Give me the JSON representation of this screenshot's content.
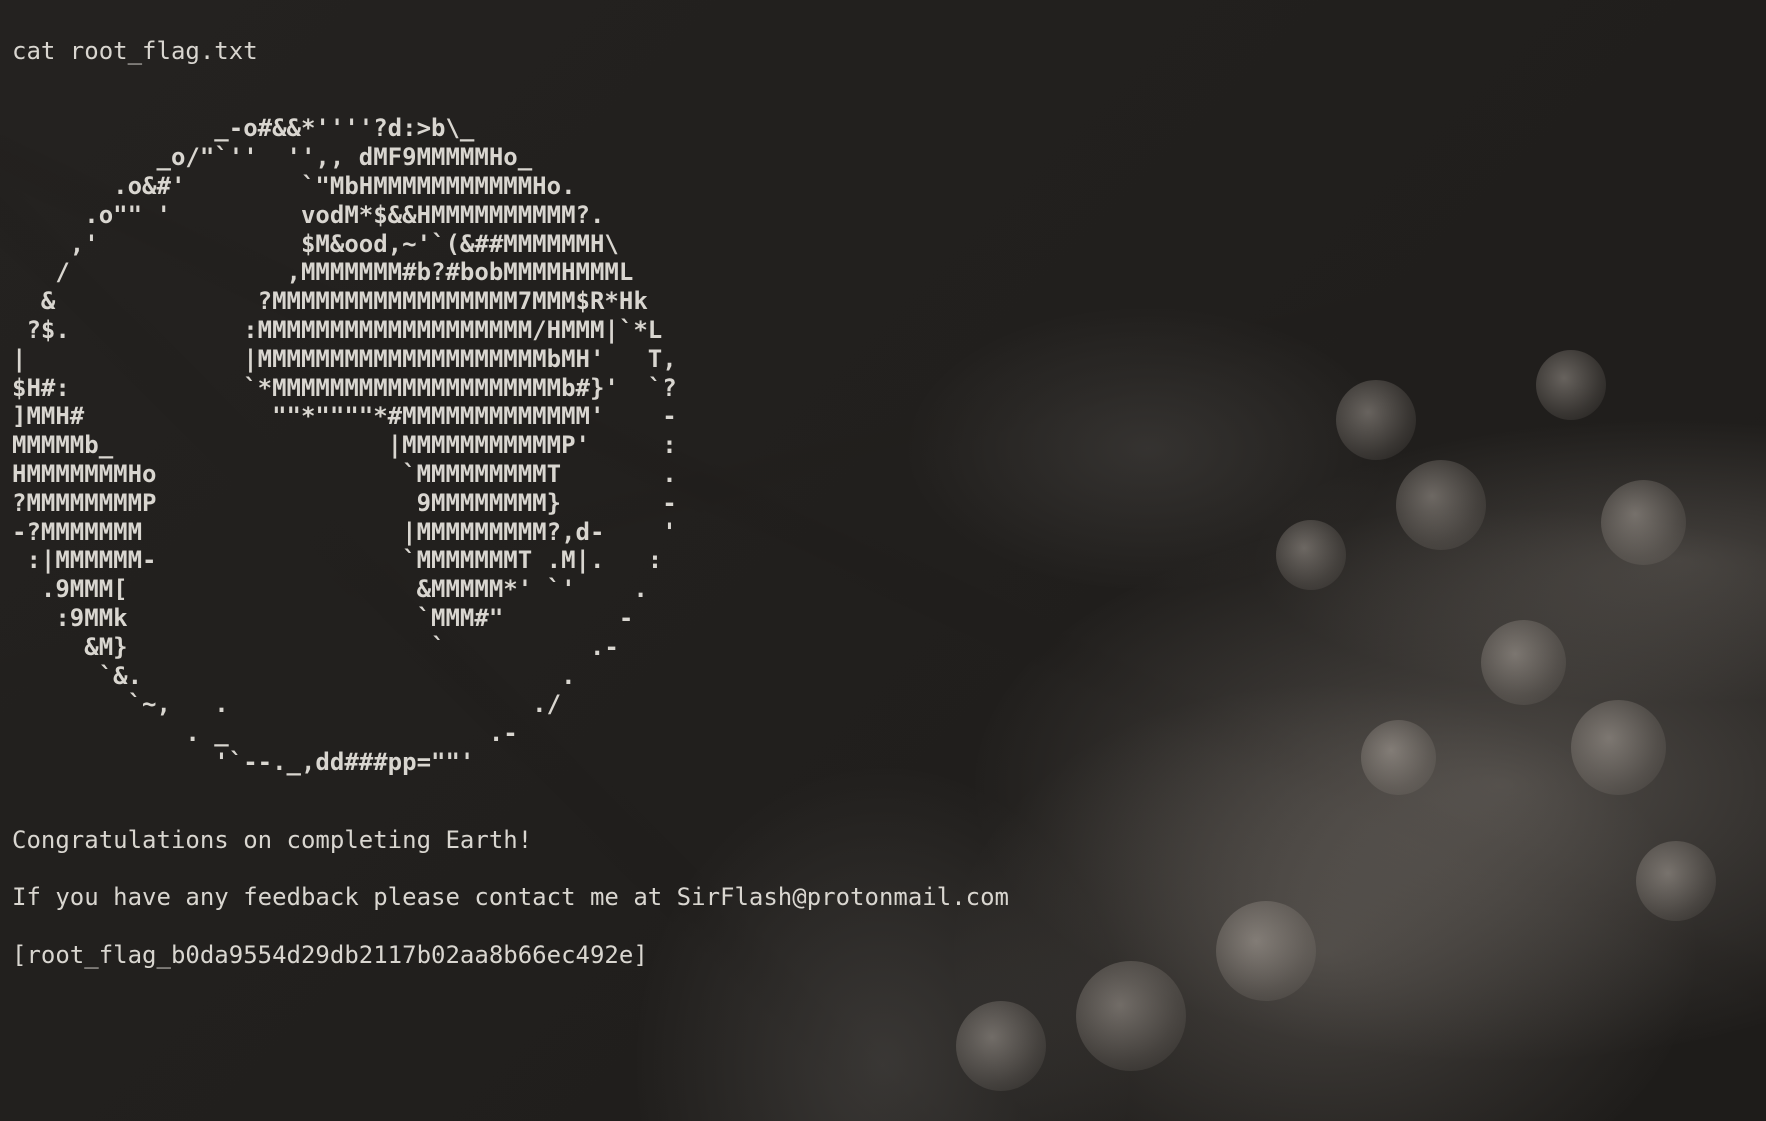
{
  "terminal": {
    "command": "cat root_flag.txt",
    "ascii_art": "              _-o#&&*''''?d:>b\\_\n          _o/\"`''  '',, dMF9MMMMMHo_\n       .o&#'        `\"MbHMMMMMMMMMMMHo.\n     .o\"\" '         vodM*$&&HMMMMMMMMMM?.\n    ,'              $M&ood,~'`(&##MMMMMMH\\\n   /               ,MMMMMMM#b?#bobMMMMHMMML\n  &              ?MMMMMMMMMMMMMMMMM7MMM$R*Hk\n ?$.            :MMMMMMMMMMMMMMMMMMM/HMMM|`*L\n|               |MMMMMMMMMMMMMMMMMMMMbMH'   T,\n$H#:            `*MMMMMMMMMMMMMMMMMMMMb#}'  `?\n]MMH#             \"\"*\"\"\"\"*#MMMMMMMMMMMMM'    -\nMMMMMb_                   |MMMMMMMMMMMP'     :\nHMMMMMMMHo                 `MMMMMMMMMT       .\n?MMMMMMMMP                  9MMMMMMMM}       -\n-?MMMMMMM                  |MMMMMMMMM?,d-    '\n :|MMMMMM-                 `MMMMMMMT .M|.   :\n  .9MMM[                    &MMMMM*' `'    .\n   :9MMk                    `MMM#\"        -\n     &M}                     `          .-\n      `&.                             .\n        `~,   .                     ./\n            . _                  .-\n              '`--._,dd###pp=\"\"'",
    "congrats_line": "Congratulations on completing Earth!",
    "feedback_line": "If you have any feedback please contact me at SirFlash@protonmail.com",
    "flag_line": "[root_flag_b0da9554d29db2117b02aa8b66ec492e]"
  }
}
